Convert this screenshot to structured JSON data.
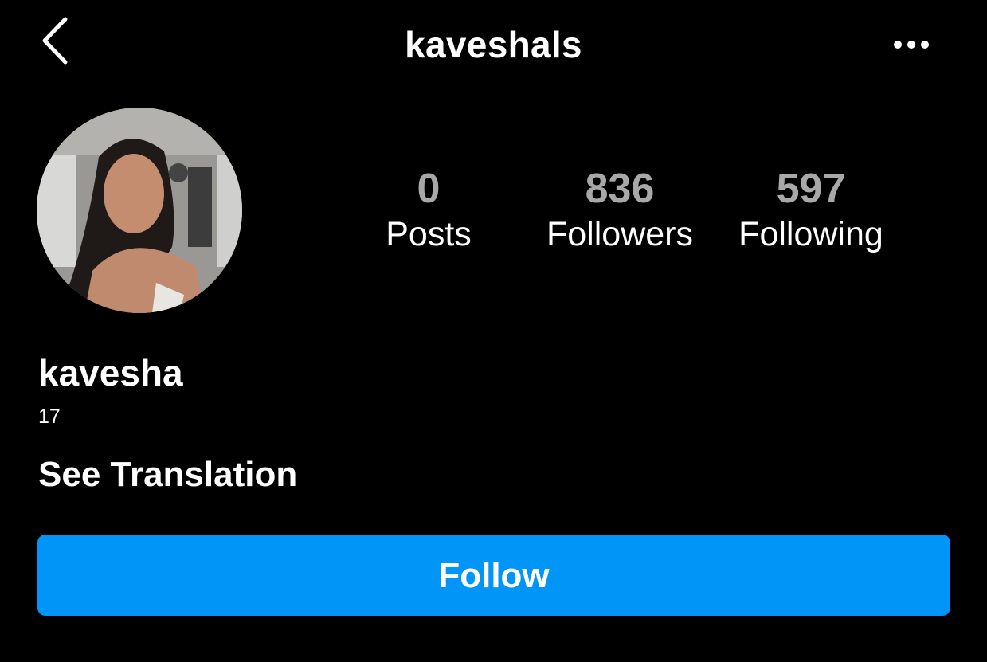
{
  "header": {
    "username": "kaveshals",
    "back_icon": "chevron-left-icon",
    "more_icon": "ellipsis-horizontal-icon"
  },
  "profile": {
    "avatar_icon": "profile-photo",
    "stats": {
      "posts": {
        "value": "0",
        "label": "Posts"
      },
      "followers": {
        "value": "836",
        "label": "Followers"
      },
      "following": {
        "value": "597",
        "label": "Following"
      }
    },
    "display_name": "kavesha",
    "bio": "17",
    "see_translation_label": "See Translation",
    "follow_label": "Follow"
  },
  "colors": {
    "background": "#000000",
    "text": "#ffffff",
    "stat_number": "#a8a8a8",
    "accent": "#0095f6"
  }
}
